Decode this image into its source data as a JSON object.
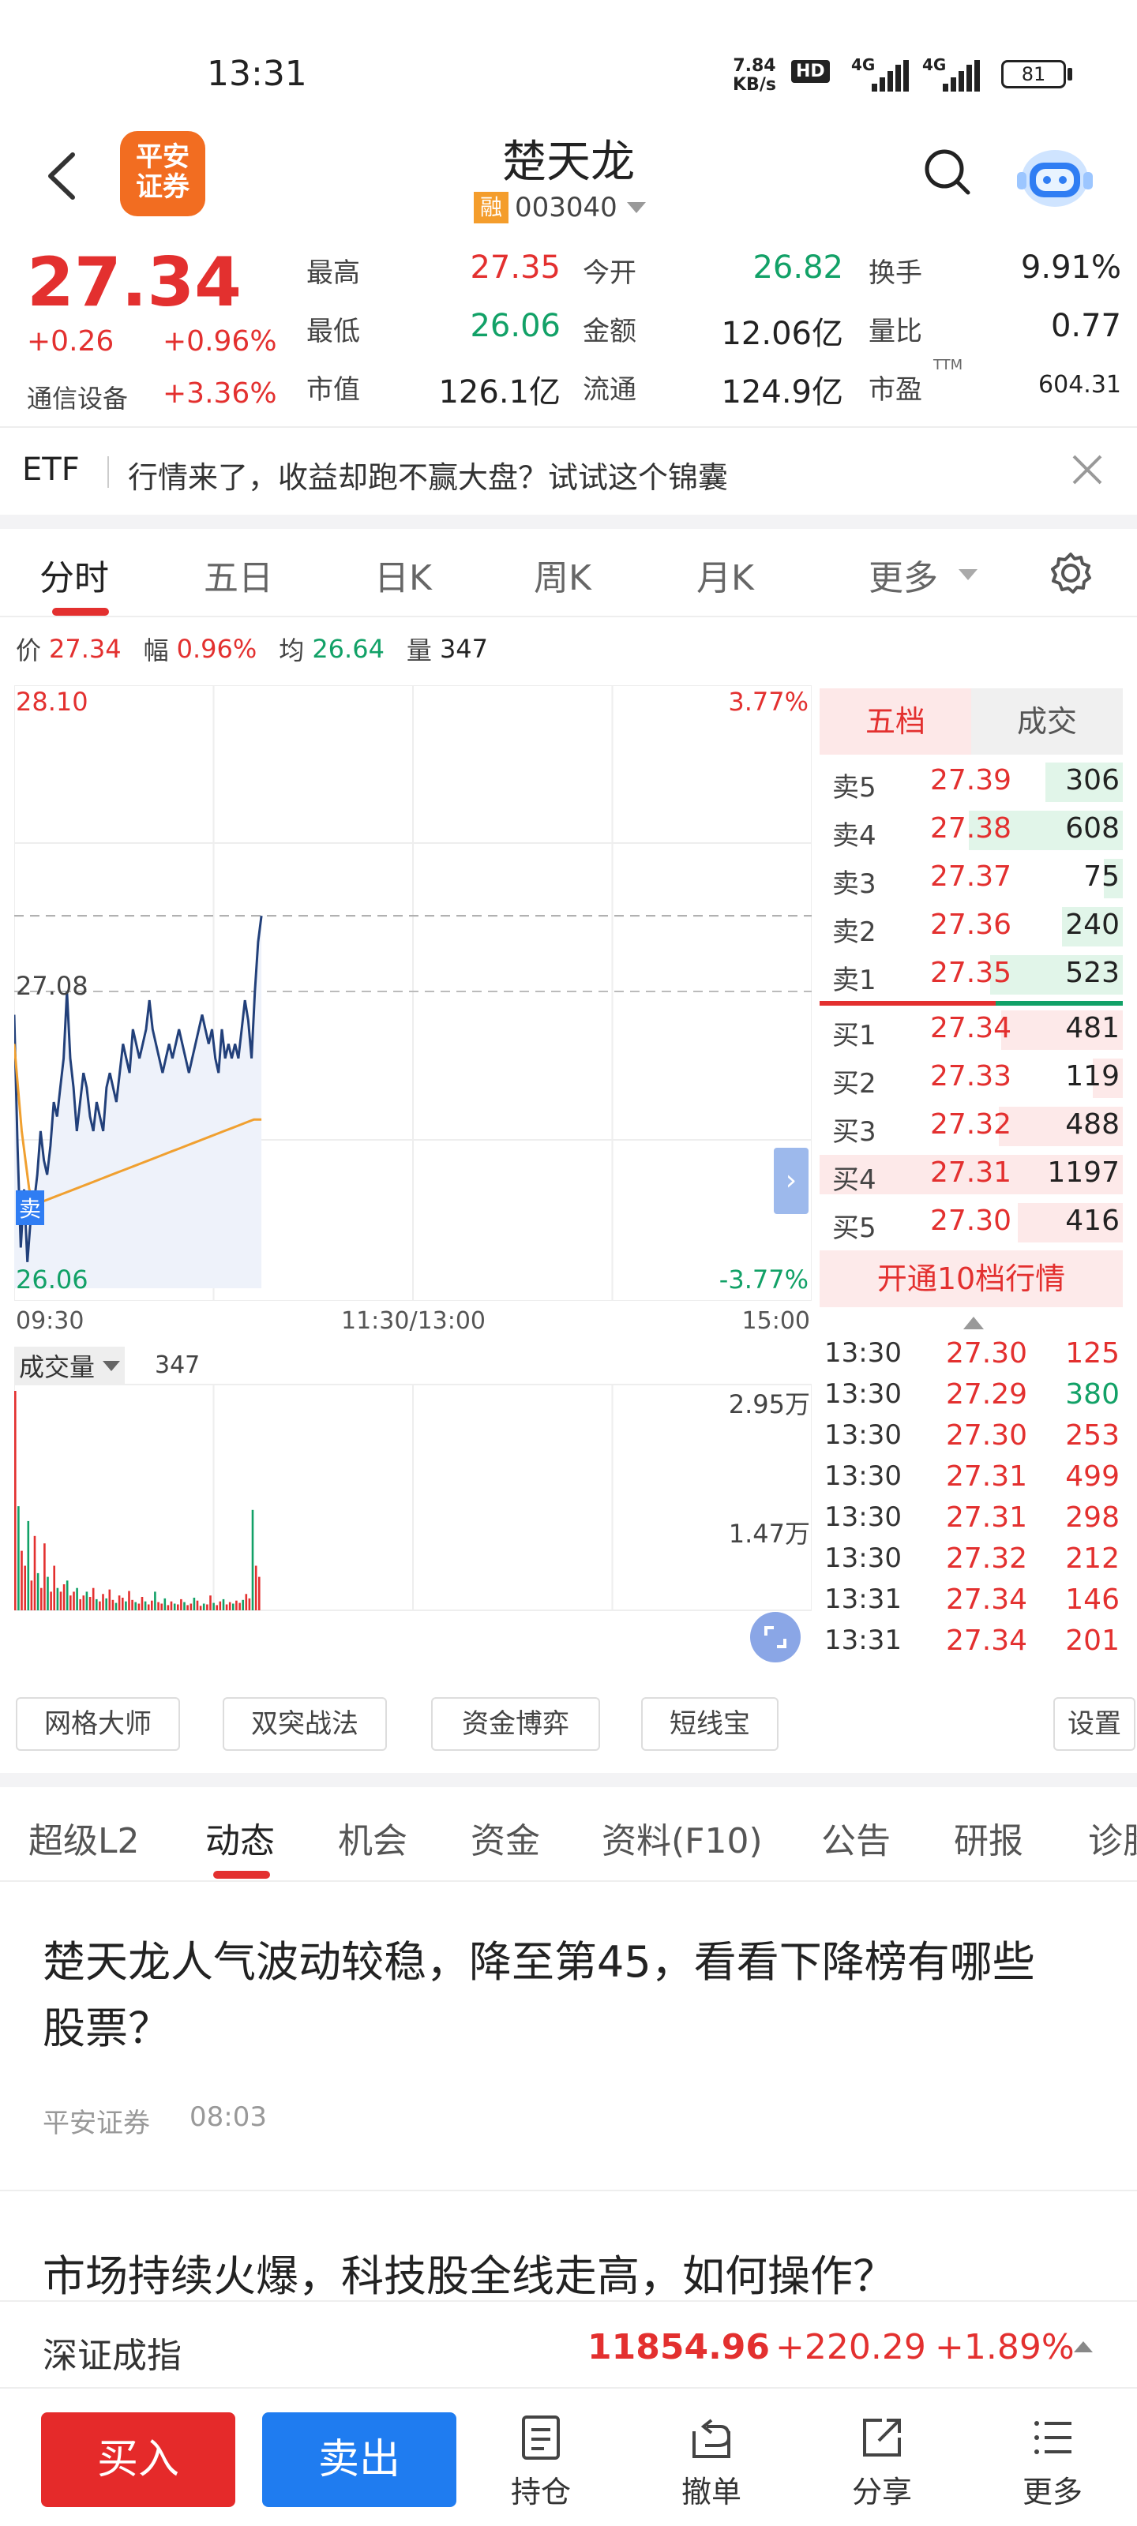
{
  "status_bar": {
    "time": "13:31",
    "net_speed_top": "7.84",
    "net_speed_bottom": "KB/s",
    "hd": "HD",
    "sig1": "4G",
    "sig2": "4G",
    "battery": "81"
  },
  "header": {
    "title": "楚天龙",
    "margin_badge": "融",
    "code": "003040",
    "logo_line1": "平安",
    "logo_line2": "证券"
  },
  "quote": {
    "price": "27.34",
    "change": "+0.26",
    "change_pct": "+0.96%",
    "sector": "通信设备",
    "sector_pct": "+3.36%",
    "cells": [
      {
        "label": "最高",
        "value": "27.35",
        "color": "red"
      },
      {
        "label": "今开",
        "value": "26.82",
        "color": "green"
      },
      {
        "label": "换手",
        "value": "9.91%",
        "color": "dark"
      },
      {
        "label": "最低",
        "value": "26.06",
        "color": "green"
      },
      {
        "label": "金额",
        "value": "12.06亿",
        "color": "dark"
      },
      {
        "label": "量比",
        "value": "0.77",
        "color": "dark"
      },
      {
        "label": "市值",
        "value": "126.1亿",
        "color": "dark"
      },
      {
        "label": "流通",
        "value": "124.9亿",
        "color": "dark"
      },
      {
        "label": "市盈",
        "value": "604.31",
        "color": "dark",
        "sup": "TTM"
      }
    ]
  },
  "banner": {
    "tag": "ETF",
    "text": "行情来了，收益却跑不赢大盘？试试这个锦囊"
  },
  "chart_tabs": [
    "分时",
    "五日",
    "日K",
    "周K",
    "月K",
    "更多"
  ],
  "info_line": {
    "price_label": "价",
    "price": "27.34",
    "range_label": "幅",
    "range": "0.96%",
    "avg_label": "均",
    "avg": "26.64",
    "vol_label": "量",
    "vol": "347"
  },
  "chart_labels": {
    "top_price": "28.10",
    "mid_price": "27.08",
    "bottom_price": "26.06",
    "top_pct": "3.77%",
    "bottom_pct": "-3.77%",
    "sell_marker": "卖",
    "time_start": "09:30",
    "time_mid": "11:30/13:00",
    "time_end": "15:00"
  },
  "volume": {
    "selector": "成交量",
    "value": "347",
    "scale_top": "2.95万",
    "scale_mid": "1.47万"
  },
  "order_book": {
    "tab_active": "五档",
    "tab_other": "成交",
    "asks": [
      {
        "label": "卖5",
        "price": "27.39",
        "vol": "306"
      },
      {
        "label": "卖4",
        "price": "27.38",
        "vol": "608"
      },
      {
        "label": "卖3",
        "price": "27.37",
        "vol": "75"
      },
      {
        "label": "卖2",
        "price": "27.36",
        "vol": "240"
      },
      {
        "label": "卖1",
        "price": "27.35",
        "vol": "523"
      }
    ],
    "bids": [
      {
        "label": "买1",
        "price": "27.34",
        "vol": "481"
      },
      {
        "label": "买2",
        "price": "27.33",
        "vol": "119"
      },
      {
        "label": "买3",
        "price": "27.32",
        "vol": "488"
      },
      {
        "label": "买4",
        "price": "27.31",
        "vol": "1197"
      },
      {
        "label": "买5",
        "price": "27.30",
        "vol": "416"
      }
    ],
    "upgrade": "开通10档行情"
  },
  "trades": [
    {
      "time": "13:30",
      "price": "27.30",
      "vol": "125",
      "color": "red"
    },
    {
      "time": "13:30",
      "price": "27.29",
      "vol": "380",
      "color": "green"
    },
    {
      "time": "13:30",
      "price": "27.30",
      "vol": "253",
      "color": "red"
    },
    {
      "time": "13:30",
      "price": "27.31",
      "vol": "499",
      "color": "red"
    },
    {
      "time": "13:30",
      "price": "27.31",
      "vol": "298",
      "color": "red"
    },
    {
      "time": "13:30",
      "price": "27.32",
      "vol": "212",
      "color": "red"
    },
    {
      "time": "13:31",
      "price": "27.34",
      "vol": "146",
      "color": "red"
    },
    {
      "time": "13:31",
      "price": "27.34",
      "vol": "201",
      "color": "red"
    }
  ],
  "tools": [
    "网格大师",
    "双突战法",
    "资金博弈",
    "短线宝"
  ],
  "tools_settings": "设置",
  "content_tabs": [
    "超级L2",
    "动态",
    "机会",
    "资金",
    "资料(F10)",
    "公告",
    "研报",
    "诊股"
  ],
  "news": [
    {
      "title": "楚天龙人气波动较稳，降至第45，看看下降榜有哪些股票？",
      "source": "平安证券",
      "time": "08:03"
    },
    {
      "title": "市场持续火爆，科技股全线走高，如何操作？"
    }
  ],
  "index_bar": {
    "name": "深证成指",
    "value": "11854.96",
    "change": "+220.29",
    "pct": "+1.89%"
  },
  "bottom_bar": {
    "buy": "买入",
    "sell": "卖出",
    "items": [
      {
        "label": "持仓",
        "icon": "holdings-icon"
      },
      {
        "label": "撤单",
        "icon": "cancel-order-icon"
      },
      {
        "label": "分享",
        "icon": "share-icon"
      },
      {
        "label": "更多",
        "icon": "more-icon"
      }
    ]
  },
  "chart_data": {
    "type": "line",
    "ylim": [
      26.06,
      28.1
    ],
    "prev_close": 27.08,
    "series": [
      {
        "values": [
          27.0,
          26.55,
          26.2,
          26.4,
          26.15,
          26.3,
          26.35,
          26.45,
          26.6,
          26.5,
          26.45,
          26.55,
          26.7,
          26.65,
          26.75,
          26.85,
          27.08,
          26.85,
          26.75,
          26.6,
          26.7,
          26.8,
          26.75,
          26.65,
          26.6,
          26.7,
          26.65,
          26.6,
          26.75,
          26.8,
          26.75,
          26.7,
          26.8,
          26.9,
          26.85,
          26.8,
          26.95,
          26.9,
          26.85,
          26.9,
          26.95,
          27.05,
          26.95,
          26.9,
          26.85,
          26.8,
          26.85,
          26.9,
          26.85,
          26.9,
          26.95,
          26.9,
          26.85,
          26.8,
          26.85,
          26.9,
          26.95,
          27.0,
          26.95,
          26.9,
          26.95,
          26.85,
          26.8,
          26.95,
          26.85,
          26.9,
          26.85,
          26.9,
          26.85,
          26.95,
          27.05,
          26.98,
          26.85,
          27.08,
          27.25,
          27.34
        ]
      },
      {
        "values": [
          26.9,
          26.6,
          26.4,
          26.35,
          26.36,
          26.37,
          26.38,
          26.39,
          26.4,
          26.41,
          26.42,
          26.43,
          26.44,
          26.45,
          26.46,
          26.47,
          26.48,
          26.49,
          26.5,
          26.51,
          26.52,
          26.53,
          26.54,
          26.55,
          26.56,
          26.57,
          26.58,
          26.59,
          26.6,
          26.61,
          26.62,
          26.63,
          26.64,
          26.64
        ]
      }
    ],
    "volume_scale": [
      0,
      29500
    ],
    "volume": [
      29500,
      14000,
      8000,
      6000,
      12000,
      4000,
      10000,
      5000,
      3000,
      9000,
      4500,
      2500,
      6000,
      3000,
      2500,
      3500,
      4000,
      2000,
      2500,
      3000,
      1500,
      2000,
      2500,
      1800,
      3000,
      1500,
      1200,
      2200,
      1600,
      2800,
      1400,
      1000,
      2000,
      1700,
      1200,
      2600,
      1400,
      1100,
      900,
      1800,
      1200,
      800,
      1300,
      2500,
      1100,
      900,
      1600,
      700,
      1200,
      900,
      800,
      1500,
      1100,
      700,
      900,
      1700,
      1300,
      600,
      900,
      800,
      2000,
      1000,
      700,
      1200,
      1500,
      800,
      1100,
      900,
      1300,
      1000,
      1400,
      2200,
      1600,
      13500,
      6000,
      4500
    ]
  }
}
